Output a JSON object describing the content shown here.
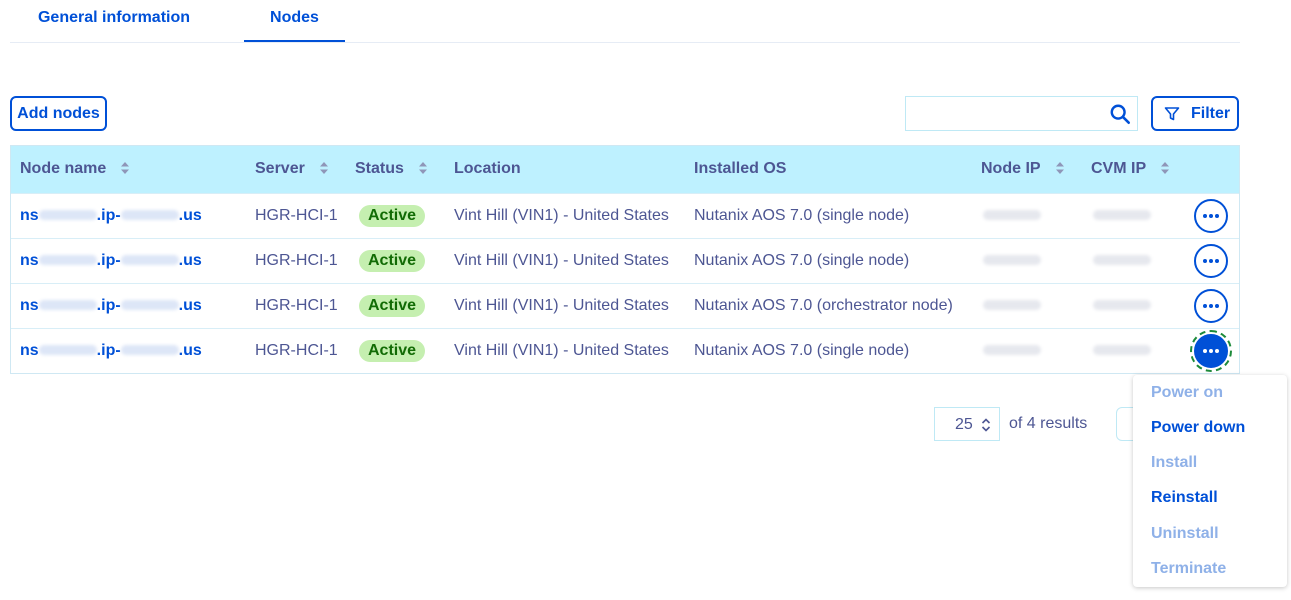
{
  "tabs": [
    {
      "label": "General information",
      "active": false
    },
    {
      "label": "Nodes",
      "active": true
    }
  ],
  "toolbar": {
    "add_nodes_label": "Add nodes",
    "search_value": "",
    "search_placeholder": "",
    "filter_label": "Filter"
  },
  "table": {
    "headers": {
      "node_name": "Node name",
      "server": "Server",
      "status": "Status",
      "location": "Location",
      "installed_os": "Installed OS",
      "node_ip": "Node IP",
      "cvm_ip": "CVM IP"
    },
    "rows": [
      {
        "node_prefix": "ns",
        "node_mid": ".ip-",
        "node_suffix": ".us",
        "server": "HGR-HCI-1",
        "status": "Active",
        "location": "Vint Hill (VIN1) - United States",
        "os": "Nutanix AOS 7.0 (single node)"
      },
      {
        "node_prefix": "ns",
        "node_mid": ".ip-",
        "node_suffix": ".us",
        "server": "HGR-HCI-1",
        "status": "Active",
        "location": "Vint Hill (VIN1) - United States",
        "os": "Nutanix AOS 7.0 (single node)"
      },
      {
        "node_prefix": "ns",
        "node_mid": ".ip-",
        "node_suffix": ".us",
        "server": "HGR-HCI-1",
        "status": "Active",
        "location": "Vint Hill (VIN1) - United States",
        "os": "Nutanix AOS 7.0 (orchestrator node)"
      },
      {
        "node_prefix": "ns",
        "node_mid": ".ip-",
        "node_suffix": ".us",
        "server": "HGR-HCI-1",
        "status": "Active",
        "location": "Vint Hill (VIN1) - United States",
        "os": "Nutanix AOS 7.0 (single node)"
      }
    ]
  },
  "pagination": {
    "page_size": "25",
    "results_text": "of 4 results"
  },
  "actions_menu": {
    "items": [
      {
        "label": "Power on",
        "enabled": false
      },
      {
        "label": "Power down",
        "enabled": true
      },
      {
        "label": "Install",
        "enabled": false
      },
      {
        "label": "Reinstall",
        "enabled": true
      },
      {
        "label": "Uninstall",
        "enabled": false
      },
      {
        "label": "Terminate",
        "enabled": false
      }
    ]
  },
  "colors": {
    "primary": "#0050d7",
    "text": "#4d5693",
    "header_bg": "#bef1ff",
    "active_badge_bg": "#c5efb0",
    "active_badge_text": "#116b04",
    "disabled_menu": "#8fb1e8"
  },
  "icons": {
    "search": "search-icon",
    "filter": "filter-icon",
    "sort": "sort-icon",
    "more": "more-options-icon",
    "select": "chevron-up-down-icon"
  }
}
